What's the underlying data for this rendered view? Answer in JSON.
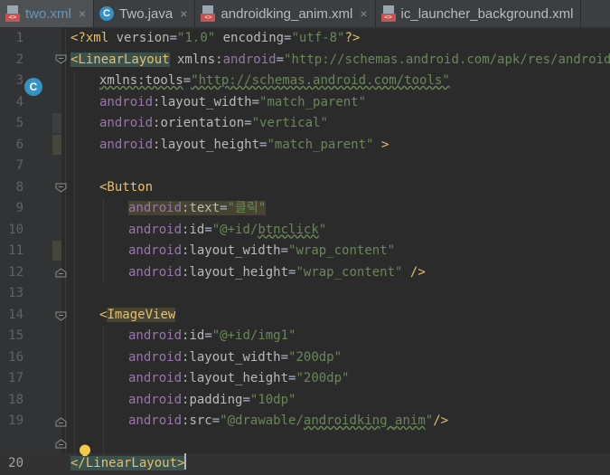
{
  "tabs": [
    {
      "label": "two.xml",
      "icon": "xml-file-icon",
      "active": true,
      "closable": true
    },
    {
      "label": "Two.java",
      "icon": "java-class-icon",
      "active": false,
      "closable": true
    },
    {
      "label": "androidking_anim.xml",
      "icon": "xml-file-icon",
      "active": false,
      "closable": true
    },
    {
      "label": "ic_launcher_background.xml",
      "icon": "xml-file-icon",
      "active": false,
      "closable": false
    }
  ],
  "close_glyph": "×",
  "gutter": {
    "line_numbers": [
      "1",
      "2",
      "3",
      "4",
      "5",
      "6",
      "7",
      "8",
      "9",
      "10",
      "11",
      "12",
      "13",
      "14",
      "15",
      "16",
      "17",
      "18",
      "19",
      "20"
    ],
    "current_line": "20",
    "class_badge": "C",
    "xml_tag_label": "<>"
  },
  "code": {
    "l1": {
      "a": "<?xml ",
      "b": "version",
      "c": "=",
      "d": "\"1.0\"",
      "e": " encoding",
      "f": "=",
      "g": "\"utf-8\"",
      "h": "?>"
    },
    "l2": {
      "a": "<LinearLayout",
      "b": " xmlns:",
      "c": "android",
      "d": "=",
      "e": "\"http://schemas.android.com/apk/res/android\""
    },
    "l3": {
      "a": "xmlns:tools",
      "b": "=",
      "c": "\"http://schemas.android.com/tools\""
    },
    "l4": {
      "a": "android",
      "b": ":layout_width",
      "c": "=",
      "d": "\"match_parent\""
    },
    "l5": {
      "a": "android",
      "b": ":orientation",
      "c": "=",
      "d": "\"vertical\""
    },
    "l6": {
      "a": "android",
      "b": ":layout_height",
      "c": "=",
      "d": "\"match_parent\"",
      "e": " >"
    },
    "l8": {
      "a": "<Button"
    },
    "l9": {
      "a": "android",
      "b": ":text",
      "c": "=",
      "d": "\"클릭\""
    },
    "l10": {
      "a": "android",
      "b": ":id",
      "c": "=",
      "d": "\"@+id/",
      "e": "btnclick",
      "f": "\""
    },
    "l11": {
      "a": "android",
      "b": ":layout_width",
      "c": "=",
      "d": "\"wrap_content\""
    },
    "l12": {
      "a": "android",
      "b": ":layout_height",
      "c": "=",
      "d": "\"wrap_content\"",
      "e": " />"
    },
    "l14": {
      "a": "<",
      "b": "ImageView"
    },
    "l15": {
      "a": "android",
      "b": ":id",
      "c": "=",
      "d": "\"@+id/img1\""
    },
    "l16": {
      "a": "android",
      "b": ":layout_width",
      "c": "=",
      "d": "\"200dp\""
    },
    "l17": {
      "a": "android",
      "b": ":layout_height",
      "c": "=",
      "d": "\"200dp\""
    },
    "l18": {
      "a": "android",
      "b": ":padding",
      "c": "=",
      "d": "\"10dp\""
    },
    "l19": {
      "a": "android",
      "b": ":src",
      "c": "=",
      "d": "\"@drawable/",
      "e": "androidking_anim",
      "f": "\"",
      "g": "/>"
    },
    "l20": {
      "a": "</LinearLayout",
      "b": ">"
    }
  },
  "colors": {
    "background": "#2b2b2b",
    "tag": "#e8bf6a",
    "namespace": "#9876aa",
    "string": "#6a8759",
    "text": "#a9b7c6",
    "active_tab": "#6897bb"
  }
}
